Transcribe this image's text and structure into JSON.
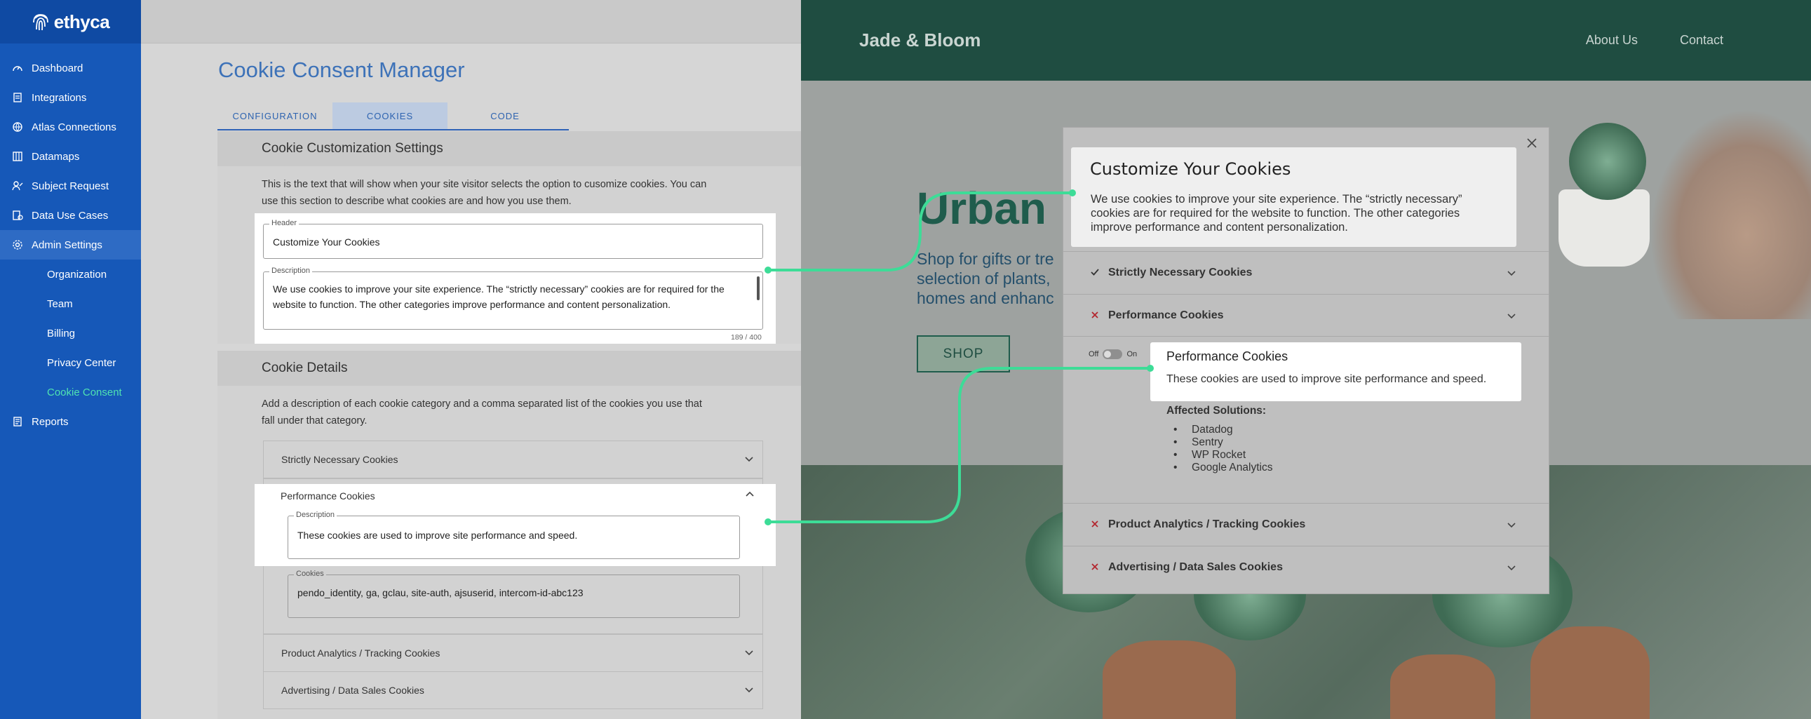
{
  "sidebar": {
    "logo_text": "ethyca",
    "items": [
      {
        "label": "Dashboard",
        "icon": "gauge-icon"
      },
      {
        "label": "Integrations",
        "icon": "integrations-icon"
      },
      {
        "label": "Atlas Connections",
        "icon": "globe-icon"
      },
      {
        "label": "Datamaps",
        "icon": "columns-icon"
      },
      {
        "label": "Subject Request",
        "icon": "user-request-icon"
      },
      {
        "label": "Data Use Cases",
        "icon": "data-use-icon"
      },
      {
        "label": "Admin Settings",
        "icon": "gear-icon"
      },
      {
        "label": "Organization"
      },
      {
        "label": "Team"
      },
      {
        "label": "Billing"
      },
      {
        "label": "Privacy Center"
      },
      {
        "label": "Cookie Consent"
      },
      {
        "label": "Reports",
        "icon": "reports-icon"
      }
    ]
  },
  "main": {
    "title": "Cookie Consent Manager",
    "tabs": [
      {
        "label": "CONFIGURATION"
      },
      {
        "label": "COOKIES"
      },
      {
        "label": "CODE"
      }
    ],
    "customization": {
      "heading": "Cookie Customization Settings",
      "description": "This is the text that will show when your site visitor selects the option to cusomize cookies. You can use this section to describe what cookies are and how you use them.",
      "header_legend": "Header",
      "header_value": "Customize Your Cookies",
      "description_legend": "Description",
      "description_value": "We use cookies to improve your site experience. The “strictly necessary” cookies are for required for the website to function. The  other categories improve performance and content personalization.",
      "counter": "189 / 400"
    },
    "details": {
      "heading": "Cookie Details",
      "description": "Add a description of each cookie category and a comma separated list of the cookies you use that fall under that category.",
      "categories": [
        {
          "label": "Strictly Necessary Cookies"
        },
        {
          "label": "Performance Cookies"
        },
        {
          "label": "Product Analytics / Tracking Cookies"
        },
        {
          "label": "Advertising / Data Sales Cookies"
        }
      ],
      "perf_description_legend": "Description",
      "perf_description_value": "These cookies are used to improve site performance and speed.",
      "perf_cookies_legend": "Cookies",
      "perf_cookies_value": "pendo_identity, ga, gclau, site-auth, ajsuserid, intercom-id-abc123"
    }
  },
  "site": {
    "brand": "Jade & Bloom",
    "nav": [
      "About Us",
      "Contact"
    ],
    "hero_title": "Urban",
    "hero_sub": [
      "Shop for gifts or tre",
      "selection of plants,",
      "homes and enhanc"
    ],
    "shop_label": "SHOP"
  },
  "modal": {
    "title": "Customize Your Cookies",
    "description": "We use cookies to improve your site experience. The “strictly necessary” cookies are for required for the website to function. The  other categories improve performance and content personalization.",
    "rows": [
      {
        "label": "Strictly Necessary Cookies",
        "status": "check"
      },
      {
        "label": "Performance Cookies",
        "status": "x"
      },
      {
        "label": "Product Analytics / Tracking Cookies",
        "status": "x"
      },
      {
        "label": "Advertising / Data Sales Cookies",
        "status": "x"
      }
    ],
    "toggle_off": "Off",
    "toggle_on": "On",
    "perf_title": "Performance Cookies",
    "perf_desc": "These cookies are used to improve site performance and speed.",
    "affected_title": "Affected Solutions:",
    "affected": [
      "Datadog",
      "Sentry",
      "WP Rocket",
      "Google Analytics"
    ]
  },
  "colors": {
    "sidebar": "#1658b8",
    "accent_green": "#3ddc97",
    "site_header": "#1f4d41",
    "x_mark": "#b3262e"
  }
}
